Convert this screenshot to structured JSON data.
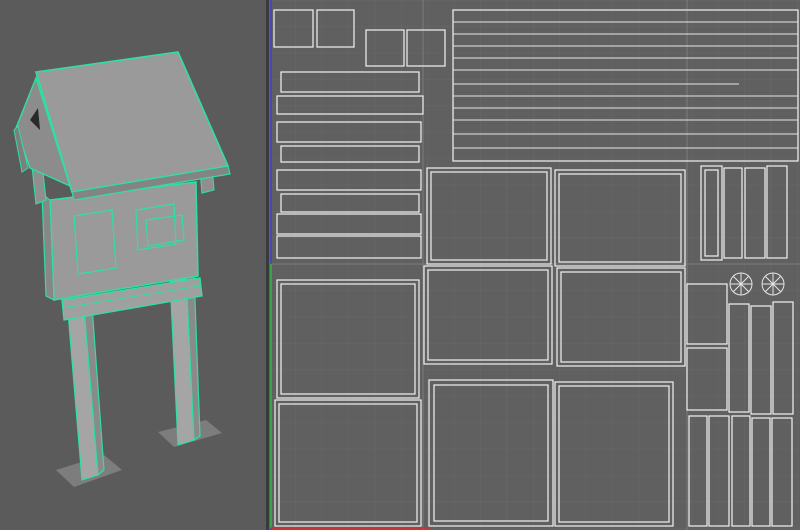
{
  "app": {
    "name": "",
    "panels": [
      {
        "id": "viewport-3d",
        "label": ""
      },
      {
        "id": "uv-editor",
        "label": ""
      }
    ]
  },
  "colors": {
    "viewport_bg": "#5b5b5b",
    "uv_bg": "#606060",
    "grid_line": "#707070",
    "grid_major": "#7a7a7a",
    "selection_wire": "#2fe0a0",
    "mesh_face": "#9a9a9a",
    "uv_shell": "#f2f2f2",
    "axis_u": "#d03030",
    "axis_v": "#30c030",
    "axis_blue": "#4040d0"
  },
  "icons": {
    "model": "notice-board-3d-mesh",
    "uv_layout": "uv-shell-layout"
  }
}
